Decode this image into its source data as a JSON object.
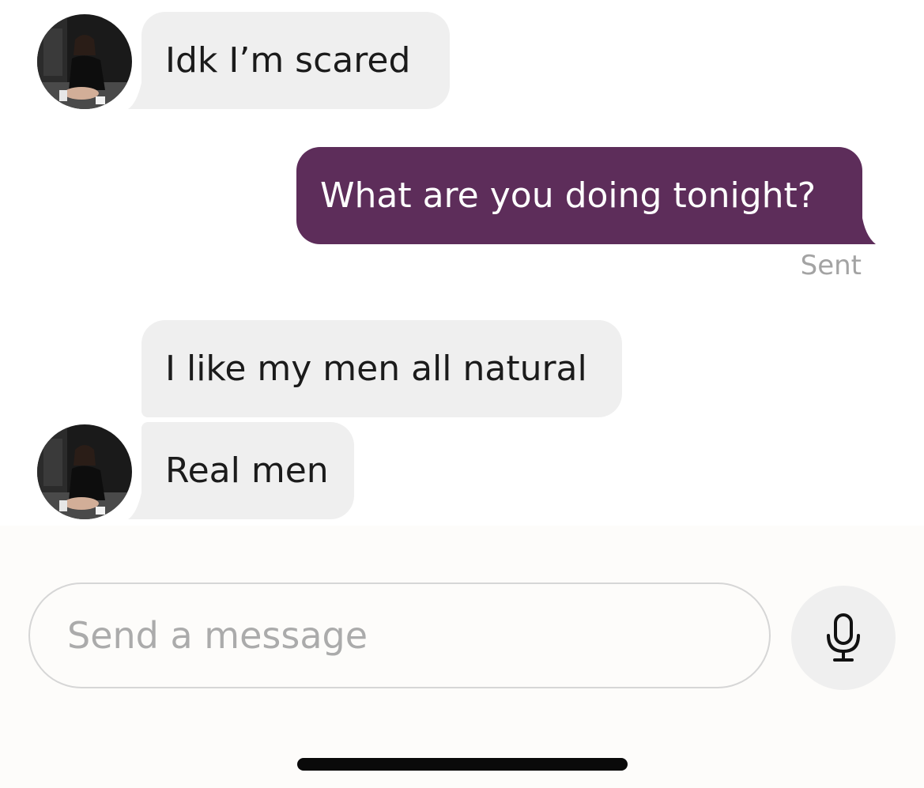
{
  "messages": [
    {
      "id": "m1",
      "direction": "incoming",
      "text": "Idk I’m scared"
    },
    {
      "id": "m2",
      "direction": "outgoing",
      "text": "What are you doing tonight?",
      "status": "Sent"
    },
    {
      "id": "m3",
      "direction": "incoming",
      "text": "I like my men all natural"
    },
    {
      "id": "m4",
      "direction": "incoming",
      "text": "Real men"
    }
  ],
  "composer": {
    "placeholder": "Send a message",
    "value": "",
    "mic_icon": "microphone-icon"
  },
  "colors": {
    "outgoing_bubble": "#5d2d5a",
    "incoming_bubble": "#efefef",
    "status_text": "#a3a3a3",
    "composer_background": "#fdfcfa"
  }
}
